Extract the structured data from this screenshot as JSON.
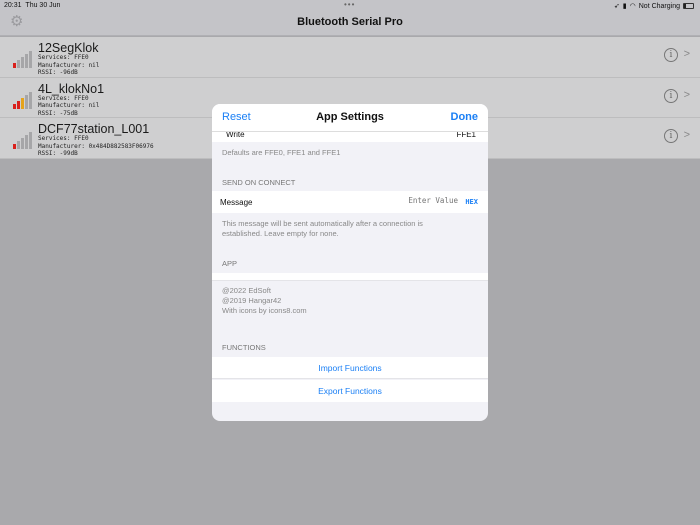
{
  "status": {
    "time": "20:31",
    "date": "Thu 30 Jun",
    "battery_label": "Not Charging"
  },
  "navbar": {
    "title": "Bluetooth Serial Pro"
  },
  "devices": [
    {
      "name": "12SegKlok",
      "services": "Services: FFE0",
      "manufacturer": "Manufacturer: nil",
      "rssi": "RSSI: -96dB",
      "signal_bars": 1
    },
    {
      "name": "4L_klokNo1",
      "services": "Services: FFE0",
      "manufacturer": "Manufacturer: nil",
      "rssi": "RSSI: -75dB",
      "signal_bars": 3
    },
    {
      "name": "DCF77station_L001",
      "services": "Services: FFE0",
      "manufacturer": "Manufacturer: 0x484D882583F06976",
      "rssi": "RSSI: -99dB",
      "signal_bars": 1
    }
  ],
  "modal": {
    "title": "App Settings",
    "reset": "Reset",
    "done": "Done",
    "write_label": "Write",
    "write_value": "FFE1",
    "defaults_note": "Defaults are FFE0, FFE1 and FFE1",
    "send_on_connect_header": "SEND ON CONNECT",
    "message_label": "Message",
    "message_placeholder": "Enter Value",
    "hex_label": "HEX",
    "message_note_1": "This message will be sent automatically after a connection is",
    "message_note_2": "established. Leave empty for none.",
    "app_header": "APP",
    "credits": [
      "@2022 EdSoft",
      "@2019 Hangar42",
      "With icons by icons8.com"
    ],
    "functions_header": "FUNCTIONS",
    "import": "Import Functions",
    "export": "Export Functions"
  }
}
